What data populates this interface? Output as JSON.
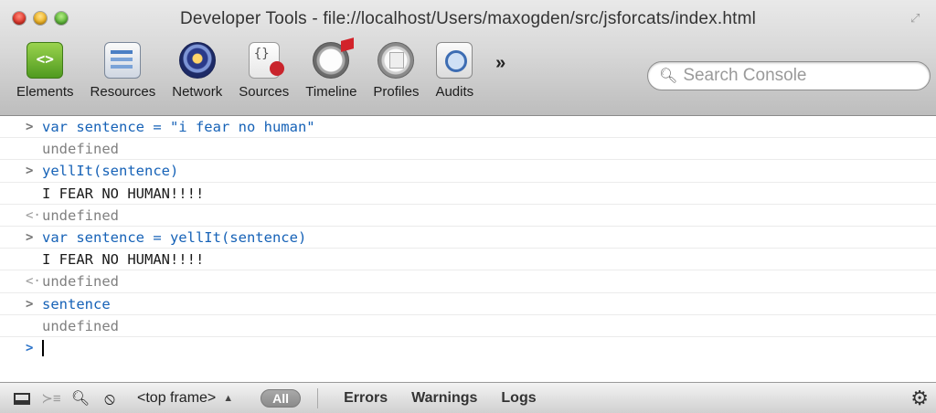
{
  "window": {
    "title": "Developer Tools - file://localhost/Users/maxogden/src/jsforcats/index.html"
  },
  "toolbar": {
    "tabs": [
      {
        "label": "Elements",
        "icon": "elements-icon"
      },
      {
        "label": "Resources",
        "icon": "resources-icon"
      },
      {
        "label": "Network",
        "icon": "network-icon"
      },
      {
        "label": "Sources",
        "icon": "sources-icon"
      },
      {
        "label": "Timeline",
        "icon": "timeline-icon"
      },
      {
        "label": "Profiles",
        "icon": "profiles-icon"
      },
      {
        "label": "Audits",
        "icon": "audits-icon"
      }
    ],
    "overflow_label": "»",
    "search_placeholder": "Search Console",
    "elements_glyph": "<>"
  },
  "console": {
    "lines": [
      {
        "kind": "input",
        "prefix": ">",
        "text": "var sentence = \"i fear no human\""
      },
      {
        "kind": "result",
        "prefix": "",
        "text": "undefined"
      },
      {
        "kind": "input",
        "prefix": ">",
        "text": "yellIt(sentence)"
      },
      {
        "kind": "log",
        "prefix": "",
        "text": "I FEAR NO HUMAN!!!!"
      },
      {
        "kind": "result",
        "prefix": "<·",
        "text": "undefined"
      },
      {
        "kind": "input",
        "prefix": ">",
        "text": "var sentence = yellIt(sentence)"
      },
      {
        "kind": "log",
        "prefix": "",
        "text": "I FEAR NO HUMAN!!!!"
      },
      {
        "kind": "result",
        "prefix": "<·",
        "text": "undefined"
      },
      {
        "kind": "input",
        "prefix": ">",
        "text": "sentence"
      },
      {
        "kind": "result",
        "prefix": "",
        "text": "undefined"
      }
    ],
    "prompt_prefix": ">"
  },
  "statusbar": {
    "frame_select": "<top frame>",
    "all_label": "All",
    "filters": [
      "Errors",
      "Warnings",
      "Logs"
    ]
  },
  "colors": {
    "input_text": "#1662b7",
    "result_text": "#808080",
    "log_text": "#1a1a1a",
    "prompt": "#2d74c9"
  }
}
